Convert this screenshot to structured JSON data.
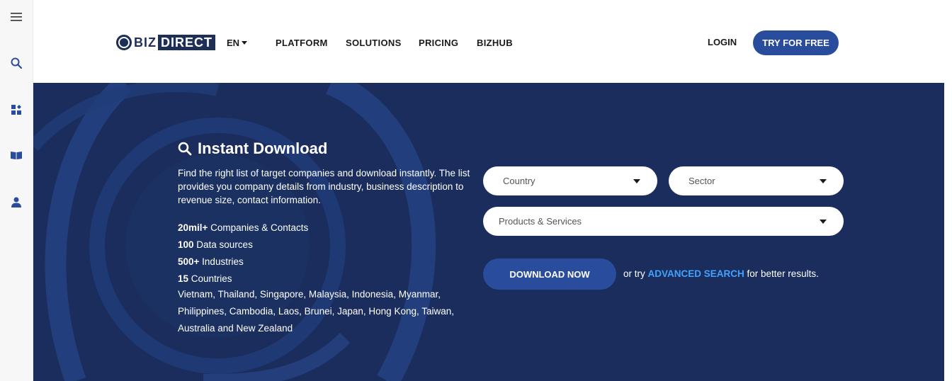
{
  "header": {
    "logo_biz": "BIZ",
    "logo_direct": "DIRECT",
    "language": "EN",
    "nav": [
      "PLATFORM",
      "SOLUTIONS",
      "PRICING",
      "BIZHUB"
    ],
    "login": "LOGIN",
    "try_free": "TRY FOR FREE"
  },
  "rail": {
    "icons": [
      "menu-icon",
      "search-icon",
      "apps-icon",
      "book-icon",
      "user-icon"
    ]
  },
  "hero": {
    "title": "Instant Download",
    "description": "Find the right list of target companies and download instantly. The list provides you company details from industry, business description to revenue size, contact information.",
    "stats": [
      {
        "value": "20mil+",
        "label": " Companies & Contacts"
      },
      {
        "value": "100",
        "label": " Data sources"
      },
      {
        "value": "500+",
        "label": " Industries"
      },
      {
        "value": "15",
        "label": " Countries"
      }
    ],
    "countries": "Vietnam, Thailand, Singapore, Malaysia, Indonesia, Myanmar, Philippines, Cambodia, Laos, Brunei, Japan, Hong Kong, Taiwan, Australia and New Zealand"
  },
  "search": {
    "country": "Country",
    "sector": "Sector",
    "products": "Products & Services",
    "download": "DOWNLOAD NOW",
    "or_try": "or try ",
    "advanced": "ADVANCED SEARCH",
    "suffix": " for better results."
  },
  "colors": {
    "hero_bg": "#1a2d5c",
    "button": "#294c9c",
    "link": "#3fa3ff"
  }
}
